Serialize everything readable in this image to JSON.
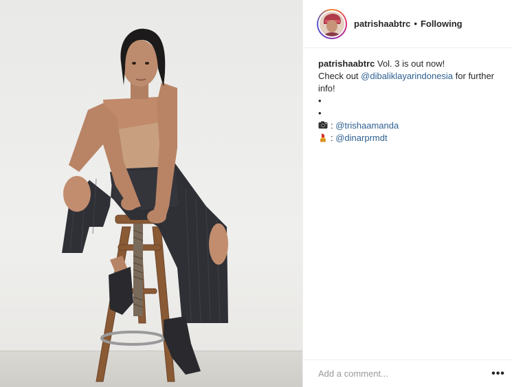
{
  "post": {
    "username": "patrishaabtrc",
    "separator": "•",
    "follow_status": "Following"
  },
  "caption": {
    "username": "patrishaabtrc",
    "text_1": " Vol. 3 is out now!",
    "text_2": "Check out ",
    "mention_1": "@dibaliklayarindonesia",
    "text_3": " for further info!",
    "bullet_1": "•",
    "bullet_2": "•",
    "credit_1_sep": ": ",
    "mention_2": "@trishaamanda",
    "credit_2_sep": ": ",
    "mention_3": "@dinarprmdt",
    "credit_1_icon": "camera-icon",
    "credit_2_icon": "lipstick-icon"
  },
  "comment": {
    "placeholder": "Add a comment...",
    "more_label": "•••"
  },
  "colors": {
    "link": "#2c5f91",
    "text": "#262626",
    "placeholder": "#999999",
    "border": "#efefef"
  }
}
